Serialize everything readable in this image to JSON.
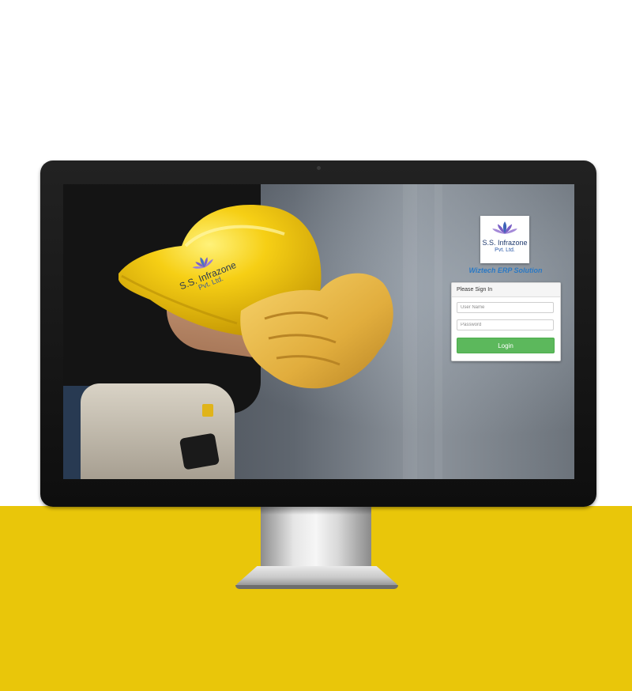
{
  "colors": {
    "band": "#e9c60a",
    "bezel": "#111111",
    "login_button": "#5cb85c",
    "app_title": "#2b79c4",
    "helmet": "#f4c811"
  },
  "icons": {
    "brand": "lotus-logo-icon"
  },
  "helmet_print": {
    "company": "S.S. Infrazone",
    "suffix": "Pvt. Ltd."
  },
  "brand": {
    "company": "S.S. Infrazone",
    "suffix": "Pvt. Ltd.",
    "app_title": "Wiztech ERP Solution"
  },
  "login": {
    "heading": "Please Sign In",
    "username_placeholder": "User Name",
    "password_placeholder": "Password",
    "button_label": "Login"
  }
}
